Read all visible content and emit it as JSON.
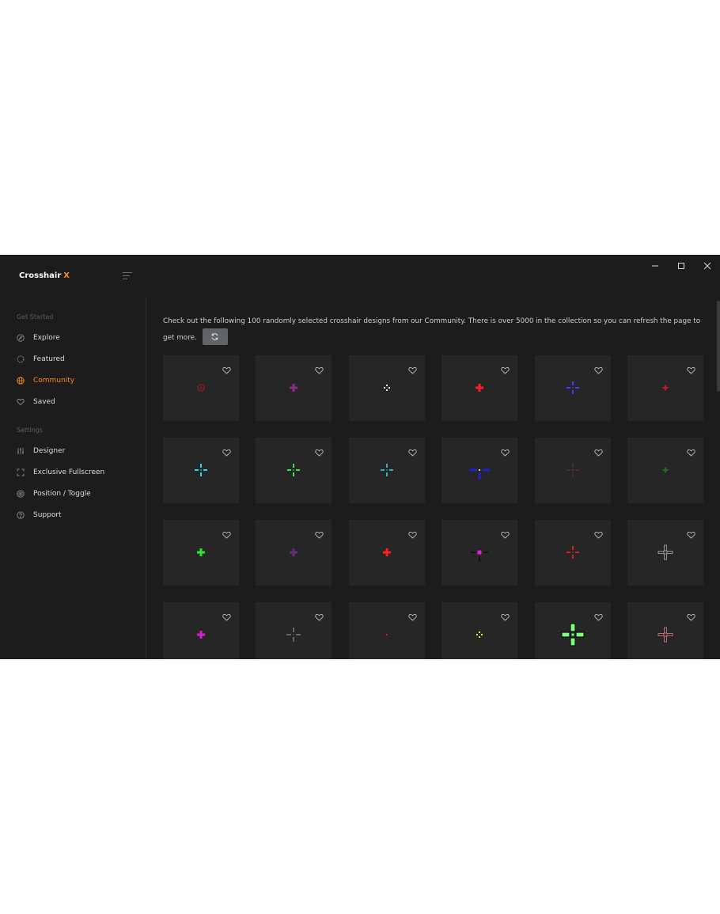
{
  "app": {
    "brand_name": "Crosshair",
    "brand_accent": "X",
    "accent_color": "#ff8a1f"
  },
  "window_controls": {
    "minimize": "–",
    "maximize": "☐",
    "close": "✕"
  },
  "sidebar": {
    "sections": [
      {
        "label": "Get Started",
        "items": [
          {
            "label": "Explore",
            "icon": "compass-icon",
            "active": false
          },
          {
            "label": "Featured",
            "icon": "badge-icon",
            "active": false
          },
          {
            "label": "Community",
            "icon": "globe-icon",
            "active": true
          },
          {
            "label": "Saved",
            "icon": "heart-icon",
            "active": false
          }
        ]
      },
      {
        "label": "Settings",
        "items": [
          {
            "label": "Designer",
            "icon": "sliders-icon",
            "active": false
          },
          {
            "label": "Exclusive Fullscreen",
            "icon": "fullscreen-icon",
            "active": false
          },
          {
            "label": "Position / Toggle",
            "icon": "target-icon",
            "active": false
          },
          {
            "label": "Support",
            "icon": "help-icon",
            "active": false
          }
        ]
      }
    ]
  },
  "main": {
    "intro_text": "Check out the following 100 randomly selected crosshair designs from our Community. There is over 5000 in the collection so you can refresh the page to get more.",
    "refresh_icon": "refresh-icon",
    "cards": [
      {
        "icon": "crosshair-circle-icon",
        "color": "#8b1a1a"
      },
      {
        "icon": "crosshair-plus-icon",
        "color": "#8a2b8a"
      },
      {
        "icon": "crosshair-dots-icon",
        "color": "#e6e6e6"
      },
      {
        "icon": "crosshair-plus-icon",
        "color": "#ff1f1f"
      },
      {
        "icon": "crosshair-gap-icon",
        "color": "#3b3bff"
      },
      {
        "icon": "crosshair-small-icon",
        "color": "#cc1a1a"
      },
      {
        "icon": "crosshair-gap-icon",
        "color": "#2fd6d6"
      },
      {
        "icon": "crosshair-gap-icon",
        "color": "#3fe63f"
      },
      {
        "icon": "crosshair-gap-icon",
        "color": "#20b8b8"
      },
      {
        "icon": "crosshair-bar-icon",
        "color": "#2020c8"
      },
      {
        "icon": "crosshair-thin-icon",
        "color": "#6a4040"
      },
      {
        "icon": "crosshair-small-icon",
        "color": "#1f6f1f"
      },
      {
        "icon": "crosshair-plus-icon",
        "color": "#2fe62f"
      },
      {
        "icon": "crosshair-plus-icon",
        "color": "#6a2a7a"
      },
      {
        "icon": "crosshair-plus-icon",
        "color": "#ff1f1f"
      },
      {
        "icon": "crosshair-square-icon",
        "color": "#e020e0"
      },
      {
        "icon": "crosshair-gap-icon",
        "color": "#d81f1f"
      },
      {
        "icon": "crosshair-outline-icon",
        "color": "#b0b0b0"
      },
      {
        "icon": "crosshair-plus-icon",
        "color": "#d020d0"
      },
      {
        "icon": "crosshair-thin-icon",
        "color": "#c8c8c8"
      },
      {
        "icon": "crosshair-dot-icon",
        "color": "#c81f1f"
      },
      {
        "icon": "crosshair-dots-icon",
        "color": "#e6e620"
      },
      {
        "icon": "crosshair-big-icon",
        "color": "#7dff7d"
      },
      {
        "icon": "crosshair-outline-icon",
        "color": "#e08080"
      }
    ]
  }
}
